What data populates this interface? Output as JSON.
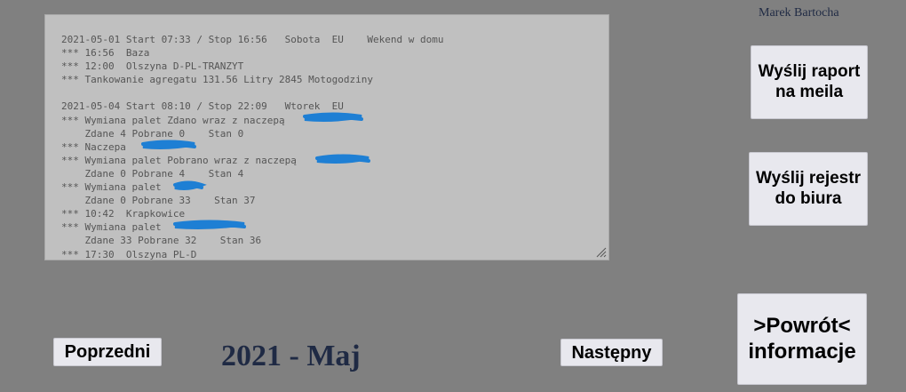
{
  "header": {
    "user_name": "Marek Bartocha"
  },
  "log": {
    "lines": [
      "2021-05-01 Start 07:33 / Stop 16:56   Sobota  EU    Wekend w domu",
      "*** 16:56  Baza",
      "*** 12:00  Olszyna D-PL-TRANZYT",
      "*** Tankowanie agregatu 131.56 Litry 2845 Motogodziny",
      "",
      "2021-05-04 Start 08:10 / Stop 22:09   Wtorek  EU",
      "*** Wymiana palet Zdano wraz z naczepą",
      "    Zdane 4 Pobrane 0    Stan 0",
      "*** Naczepa",
      "*** Wymiana palet Pobrano wraz z naczepą",
      "    Zdane 0 Pobrane 4    Stan 4",
      "*** Wymiana palet",
      "    Zdane 0 Pobrane 33    Stan 37",
      "*** 10:42  Krapkowice",
      "*** Wymiana palet",
      "    Zdane 33 Pobrane 32    Stan 36",
      "*** 17:30  Olszyna PL-D"
    ]
  },
  "buttons": {
    "send_email": "Wyślij raport\nna meila",
    "send_office": "Wyślij rejestr\ndo biura",
    "back": ">Powrót<\ninformacje",
    "previous": "Poprzedni",
    "next": "Następny"
  },
  "calendar": {
    "month_label": "2021 - Maj"
  },
  "colors": {
    "redaction": "#1e7fd4"
  }
}
